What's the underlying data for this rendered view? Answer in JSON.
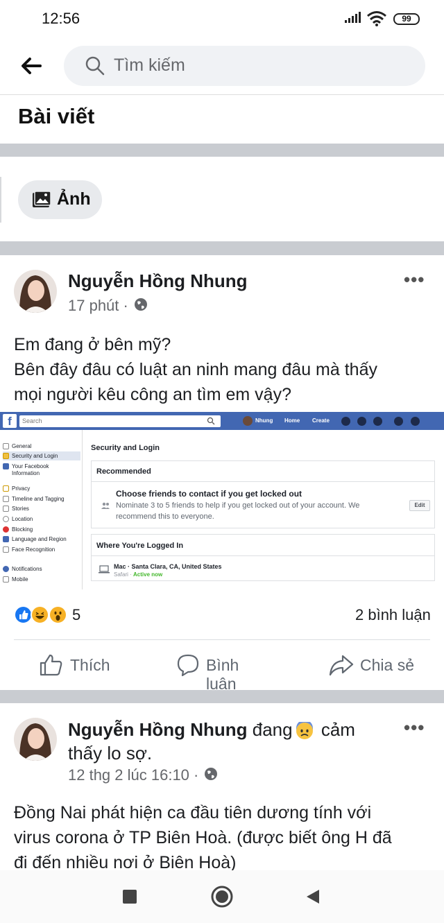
{
  "status_bar": {
    "time": "12:56",
    "battery": "99"
  },
  "header": {
    "search_placeholder": "Tìm kiếm",
    "section_title": "Bài viết",
    "filter_chip": "Ảnh"
  },
  "post1": {
    "author": "Nguyễn Hồng Nhung",
    "time": "17 phút ·",
    "text_line1": "Em đang ở bên mỹ?",
    "text_line2": "Bên đây đâu có luật an ninh mang đâu mà thấy",
    "text_line3": "mọi người kêu công an tìm em vậy?",
    "reaction_count": "5",
    "comment_count": "2 bình luận"
  },
  "embedded": {
    "search": "Search",
    "nav_user": "Nhung",
    "nav_home": "Home",
    "nav_create": "Create",
    "sidebar": [
      "General",
      "Security and Login",
      "Your Facebook",
      "Information",
      "Privacy",
      "Timeline and Tagging",
      "Stories",
      "Location",
      "Blocking",
      "Language and Region",
      "Face Recognition",
      "Notifications",
      "Mobile"
    ],
    "page_title": "Security and Login",
    "recommended": "Recommended",
    "choose_title": "Choose friends to contact if you get locked out",
    "choose_desc1": "Nominate 3 to 5 friends to help if you get locked out of your account. We",
    "choose_desc2": "recommend this to everyone.",
    "edit": "Edit",
    "logged_in": "Where You're Logged In",
    "device": "Mac · Santa Clara, CA, United States",
    "browser": "Safari ·",
    "active": "Active now"
  },
  "actions": {
    "like": "Thích",
    "comment": "Bình luận",
    "share": "Chia sẻ"
  },
  "post2": {
    "author": "Nguyễn Hồng Nhung",
    "feeling_pre": "đang",
    "feeling_post": "cảm",
    "feeling_line2": "thấy lo sợ.",
    "time": "12 thg 2 lúc 16:10 ·",
    "text_line1": "Đồng Nai phát hiện ca đầu tiên dương tính với",
    "text_line2": "virus corona ở TP Biên Hoà. (được biết ông H đã",
    "text_line3": "đi đến nhiều nơi ở Biên Hoà)"
  },
  "colors": {
    "fb_blue": "#4267b2",
    "separator": "#c9ccd1",
    "meta": "#65676b"
  }
}
